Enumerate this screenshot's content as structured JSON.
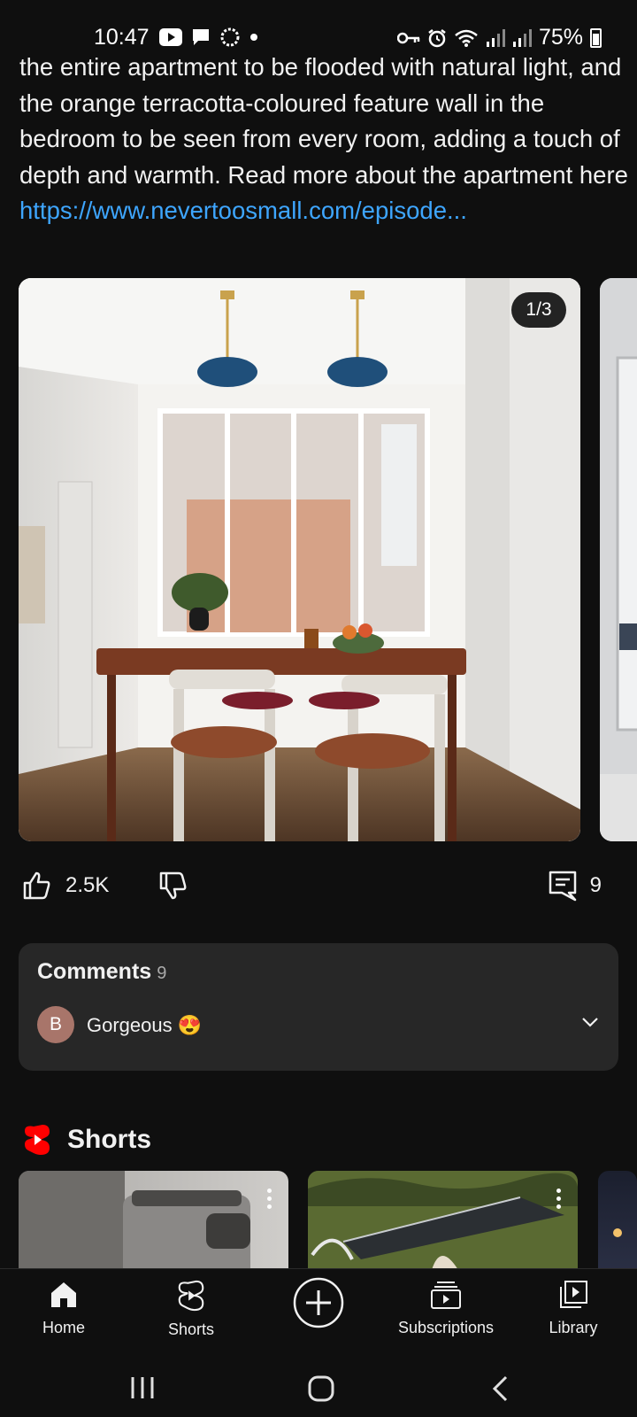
{
  "status_bar": {
    "time": "10:47",
    "battery": "75%",
    "icons": [
      "youtube-icon",
      "chat-icon",
      "sync-icon",
      "dot-icon",
      "key-icon",
      "alarm-icon",
      "wifi-icon",
      "signal-icon",
      "signal-icon",
      "battery-icon"
    ]
  },
  "post": {
    "description": "the entire apartment to be flooded with natural light, and the orange terracotta-coloured feature wall in the bedroom to be seen from every room, adding a touch of depth and warmth. Read more about the apartment here",
    "link": "https://www.nevertoosmall.com/episode...",
    "pager": "1/3",
    "likes": "2.5K",
    "comment_count": "9"
  },
  "comments": {
    "title": "Comments",
    "count": "9",
    "top_comment": {
      "avatar_letter": "B",
      "text": "Gorgeous 😍"
    }
  },
  "shorts": {
    "title": "Shorts"
  },
  "bottom_nav": {
    "items": [
      {
        "label": "Home",
        "icon": "home-icon"
      },
      {
        "label": "Shorts",
        "icon": "shorts-icon"
      },
      {
        "label": "",
        "icon": "create-plus-icon"
      },
      {
        "label": "Subscriptions",
        "icon": "subscriptions-icon"
      },
      {
        "label": "Library",
        "icon": "library-icon"
      }
    ]
  },
  "colors": {
    "background": "#0f0f0f",
    "card": "#272727",
    "link": "#3ea6ff",
    "shorts_red": "#ff0000",
    "avatar": "#a8756a"
  }
}
